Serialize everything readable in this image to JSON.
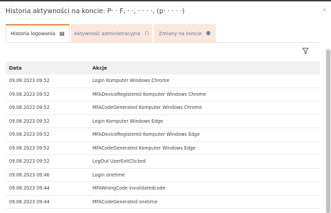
{
  "modal": {
    "title": "Historia aktywności na koncie: P· · F, · ·, · · · ·, (p· · · · ·)",
    "close_symbol": "×"
  },
  "tabs": [
    {
      "label": "Historia logowania",
      "icon": "clipboard-icon",
      "glyph": "▤",
      "active": true
    },
    {
      "label": "Aktywność administracyjna",
      "icon": "sitemap-icon",
      "glyph": "⚇",
      "active": false
    },
    {
      "label": "Zmiany na koncie",
      "icon": "users-cog-icon",
      "glyph": "⚉",
      "active": false
    }
  ],
  "filter": {
    "icon": "filter-icon"
  },
  "table": {
    "columns": [
      "Data",
      "Akcje"
    ],
    "rows": [
      {
        "date": "09.08.2023 09:52",
        "action": "Login Komputer Windows Chrome"
      },
      {
        "date": "09.08.2023 09:52",
        "action": "MFADeviceRegistered Komputer Windows Chrome"
      },
      {
        "date": "09.08.2023 09:52",
        "action": "MFACodeGenerated Komputer Windows Chrome"
      },
      {
        "date": "09.08.2023 09:52",
        "action": "Login Komputer Windows Edge"
      },
      {
        "date": "09.08.2023 09:52",
        "action": "MFADeviceRegistered Komputer Windows Edge"
      },
      {
        "date": "09.08.2023 09:52",
        "action": "MFACodeGenerated Komputer Windows Edge"
      },
      {
        "date": "09.08.2023 09:52",
        "action": "LogOut UserExitClicked"
      },
      {
        "date": "09.08.2023 09:46",
        "action": "Login onetime"
      },
      {
        "date": "09.08.2023 09:44",
        "action": "MFAWrongCode invalidatedcode"
      },
      {
        "date": "09.08.2023 09:44",
        "action": "MFACodeGenerated onetime"
      }
    ]
  },
  "colors": {
    "accent": "#f28c38",
    "inactive_tab_bg": "#fbe7db",
    "inactive_tab_text": "#5a79a8",
    "header_bg": "#f1f1f1"
  }
}
